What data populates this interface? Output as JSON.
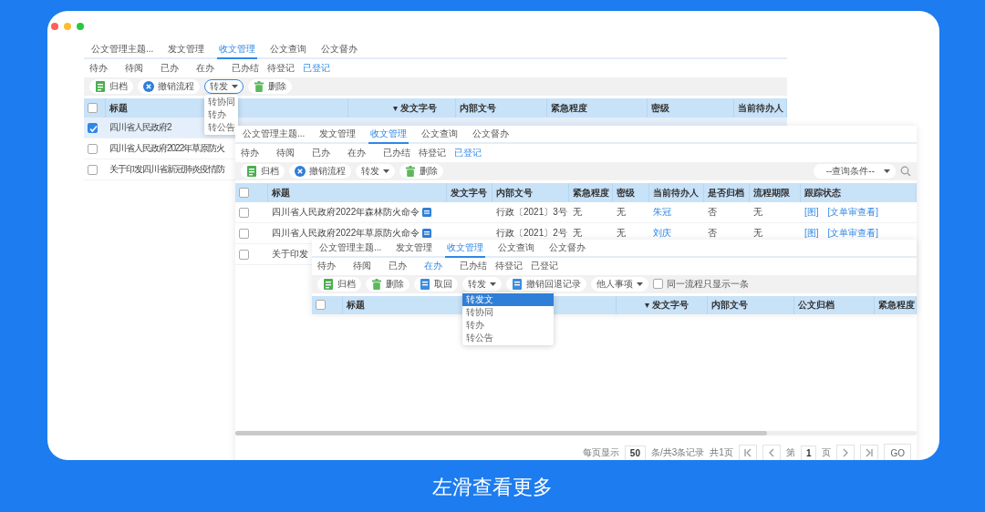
{
  "window": {
    "buttons": [
      {
        "color": "#fe5f57"
      },
      {
        "color": "#febc2e"
      },
      {
        "color": "#28c840"
      }
    ]
  },
  "panels": [
    {
      "tabs": [
        {
          "label": "公文管理主题...",
          "selected": false
        },
        {
          "label": "发文管理",
          "selected": false
        },
        {
          "label": "收文管理",
          "selected": true
        },
        {
          "label": "公文查询",
          "selected": false
        },
        {
          "label": "公文督办",
          "selected": false
        }
      ],
      "subtabs": [
        {
          "label": "待办",
          "selected": false
        },
        {
          "label": "待阅",
          "selected": false
        },
        {
          "label": "已办",
          "selected": false
        },
        {
          "label": "在办",
          "selected": false
        },
        {
          "label": "已办结",
          "selected": false
        },
        {
          "label": "待登记",
          "selected": false
        },
        {
          "label": "已登记",
          "selected": true
        }
      ],
      "toolbar": [
        {
          "kind": "archive",
          "label": "归档"
        },
        {
          "kind": "cancel",
          "label": "撤销流程"
        },
        {
          "kind": "dropdown",
          "label": "转发",
          "focused": true,
          "menu": [
            {
              "label": "转协同",
              "selected": false
            },
            {
              "label": "转办",
              "selected": false
            },
            {
              "label": "转公告",
              "selected": false
            }
          ]
        },
        {
          "kind": "delete",
          "label": "删除"
        }
      ],
      "select_all": {
        "checked": false
      },
      "columns": [
        {
          "label": "标题"
        },
        {
          "label": "发文字号",
          "sort": "▾"
        },
        {
          "label": "内部文号"
        },
        {
          "label": "紧急程度"
        },
        {
          "label": "密级"
        },
        {
          "label": "当前待办人"
        }
      ],
      "rows": [
        {
          "checked": true,
          "selected": true,
          "cells": [
            {
              "kind": "text",
              "text": "四川省人民政府2"
            }
          ]
        },
        {
          "checked": false,
          "selected": false,
          "cells": [
            {
              "kind": "text",
              "text": "四川省人民政府2022年草原防火"
            }
          ]
        },
        {
          "checked": false,
          "selected": false,
          "cells": [
            {
              "kind": "text",
              "text": "关于印发四川省新冠肺炎疫情防"
            }
          ]
        }
      ]
    },
    {
      "tabs": [
        {
          "label": "公文管理主题...",
          "selected": false
        },
        {
          "label": "发文管理",
          "selected": false
        },
        {
          "label": "收文管理",
          "selected": true
        },
        {
          "label": "公文查询",
          "selected": false
        },
        {
          "label": "公文督办",
          "selected": false
        }
      ],
      "subtabs": [
        {
          "label": "待办",
          "selected": false
        },
        {
          "label": "待阅",
          "selected": false
        },
        {
          "label": "已办",
          "selected": false
        },
        {
          "label": "在办",
          "selected": false
        },
        {
          "label": "已办结",
          "selected": false
        },
        {
          "label": "待登记",
          "selected": false
        },
        {
          "label": "已登记",
          "selected": true
        }
      ],
      "toolbar": [
        {
          "kind": "archive",
          "label": "归档"
        },
        {
          "kind": "cancel",
          "label": "撤销流程"
        },
        {
          "kind": "dropdown",
          "label": "转发",
          "focused": false
        },
        {
          "kind": "delete",
          "label": "删除"
        }
      ],
      "query_select": {
        "value": "--查询条件--"
      },
      "select_all": {
        "checked": false
      },
      "columns": [
        {
          "label": "标题"
        },
        {
          "label": "发文字号"
        },
        {
          "label": "内部文号"
        },
        {
          "label": "紧急程度"
        },
        {
          "label": "密级"
        },
        {
          "label": "当前待办人"
        },
        {
          "label": "是否归档"
        },
        {
          "label": "流程期限"
        },
        {
          "label": "跟踪状态"
        }
      ],
      "rows": [
        {
          "checked": false,
          "cells": [
            {
              "kind": "doc",
              "text": "四川省人民政府2022年森林防火命令"
            },
            {
              "kind": "text",
              "text": ""
            },
            {
              "kind": "text",
              "text": "行政〔2021〕3号"
            },
            {
              "kind": "text",
              "text": "无"
            },
            {
              "kind": "text",
              "text": "无"
            },
            {
              "kind": "link",
              "text": "朱冠"
            },
            {
              "kind": "text",
              "text": "否"
            },
            {
              "kind": "text",
              "text": "无"
            },
            {
              "kind": "links",
              "links": [
                "[图]",
                "[文单审查看]"
              ]
            }
          ]
        },
        {
          "checked": false,
          "cells": [
            {
              "kind": "doc",
              "text": "四川省人民政府2022年草原防火命令"
            },
            {
              "kind": "text",
              "text": ""
            },
            {
              "kind": "text",
              "text": "行政〔2021〕2号"
            },
            {
              "kind": "text",
              "text": "无"
            },
            {
              "kind": "text",
              "text": "无"
            },
            {
              "kind": "link",
              "text": "刘庆"
            },
            {
              "kind": "text",
              "text": "否"
            },
            {
              "kind": "text",
              "text": "无"
            },
            {
              "kind": "links",
              "links": [
                "[图]",
                "[文单审查看]"
              ]
            }
          ]
        },
        {
          "checked": false,
          "cells": [
            {
              "kind": "text",
              "text": "关于印发"
            }
          ]
        }
      ],
      "pagination": [
        {
          "kind": "text",
          "text": "每页显示"
        },
        {
          "kind": "field",
          "value": "50"
        },
        {
          "kind": "text",
          "text": "条/共3条记录"
        },
        {
          "kind": "text",
          "text": "共1页"
        },
        {
          "kind": "first"
        },
        {
          "kind": "prev"
        },
        {
          "kind": "text",
          "text": "第"
        },
        {
          "kind": "field",
          "value": "1"
        },
        {
          "kind": "text",
          "text": "页"
        },
        {
          "kind": "next"
        },
        {
          "kind": "last"
        },
        {
          "kind": "button",
          "label": "GO"
        }
      ]
    },
    {
      "tabs": [
        {
          "label": "公文管理主题...",
          "selected": false
        },
        {
          "label": "发文管理",
          "selected": false
        },
        {
          "label": "收文管理",
          "selected": true
        },
        {
          "label": "公文查询",
          "selected": false
        },
        {
          "label": "公文督办",
          "selected": false
        }
      ],
      "subtabs": [
        {
          "label": "待办",
          "selected": false
        },
        {
          "label": "待阅",
          "selected": false
        },
        {
          "label": "已办",
          "selected": false
        },
        {
          "label": "在办",
          "selected": true
        },
        {
          "label": "已办结",
          "selected": false
        },
        {
          "label": "待登记",
          "selected": false
        },
        {
          "label": "已登记",
          "selected": false
        }
      ],
      "toolbar": [
        {
          "kind": "archive",
          "label": "归档"
        },
        {
          "kind": "delete",
          "label": "删除"
        },
        {
          "kind": "retrieve",
          "label": "取回"
        },
        {
          "kind": "dropdown",
          "label": "转发",
          "focused": false,
          "menu": [
            {
              "label": "转发文",
              "selected": true
            },
            {
              "label": "转协同",
              "selected": false
            },
            {
              "label": "转办",
              "selected": false
            },
            {
              "label": "转公告",
              "selected": false
            }
          ]
        },
        {
          "kind": "retrieve",
          "label": "撤销回退记录"
        },
        {
          "kind": "dropdown",
          "label": "他人事项",
          "focused": false
        },
        {
          "kind": "checkbox",
          "label": "同一流程只显示一条",
          "checked": false
        }
      ],
      "select_all": {
        "checked": false
      },
      "columns": [
        {
          "label": "标题"
        },
        {
          "label": "发文字号",
          "sort": "▾"
        },
        {
          "label": "内部文号"
        },
        {
          "label": "公文归档"
        },
        {
          "label": "紧急程度"
        }
      ]
    }
  ],
  "caption": "左滑查看更多"
}
